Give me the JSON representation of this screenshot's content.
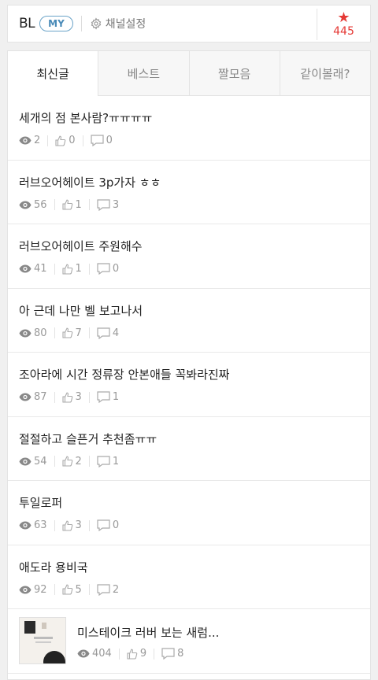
{
  "header": {
    "brand": "BL",
    "my_badge": "MY",
    "settings_label": "채널설정",
    "star_count": "445",
    "accent": "#e53935"
  },
  "tabs": [
    {
      "label": "최신글",
      "active": true
    },
    {
      "label": "베스트",
      "active": false
    },
    {
      "label": "짤모음",
      "active": false
    },
    {
      "label": "같이볼래?",
      "active": false
    }
  ],
  "posts": [
    {
      "title": "세개의 점 본사람?ㅠㅠㅠㅠ",
      "views": "2",
      "likes": "0",
      "comments": "0"
    },
    {
      "title": "러브오어헤이트 3p가자 ㅎㅎ",
      "views": "56",
      "likes": "1",
      "comments": "3"
    },
    {
      "title": "러브오어헤이트 주원해수",
      "views": "41",
      "likes": "1",
      "comments": "0"
    },
    {
      "title": "아 근데 나만 벨 보고나서",
      "views": "80",
      "likes": "7",
      "comments": "4"
    },
    {
      "title": "조아라에 시간 정류장 안본애들 꼭봐라진짜",
      "views": "87",
      "likes": "3",
      "comments": "1"
    },
    {
      "title": "절절하고 슬픈거 추천좀ㅠㅠ",
      "views": "54",
      "likes": "2",
      "comments": "1"
    },
    {
      "title": "투일로퍼",
      "views": "63",
      "likes": "3",
      "comments": "0"
    },
    {
      "title": "애도라 용비국",
      "views": "92",
      "likes": "5",
      "comments": "2"
    },
    {
      "title": "미스테이크 러버 보는 새럼...",
      "views": "404",
      "likes": "9",
      "comments": "8"
    }
  ]
}
